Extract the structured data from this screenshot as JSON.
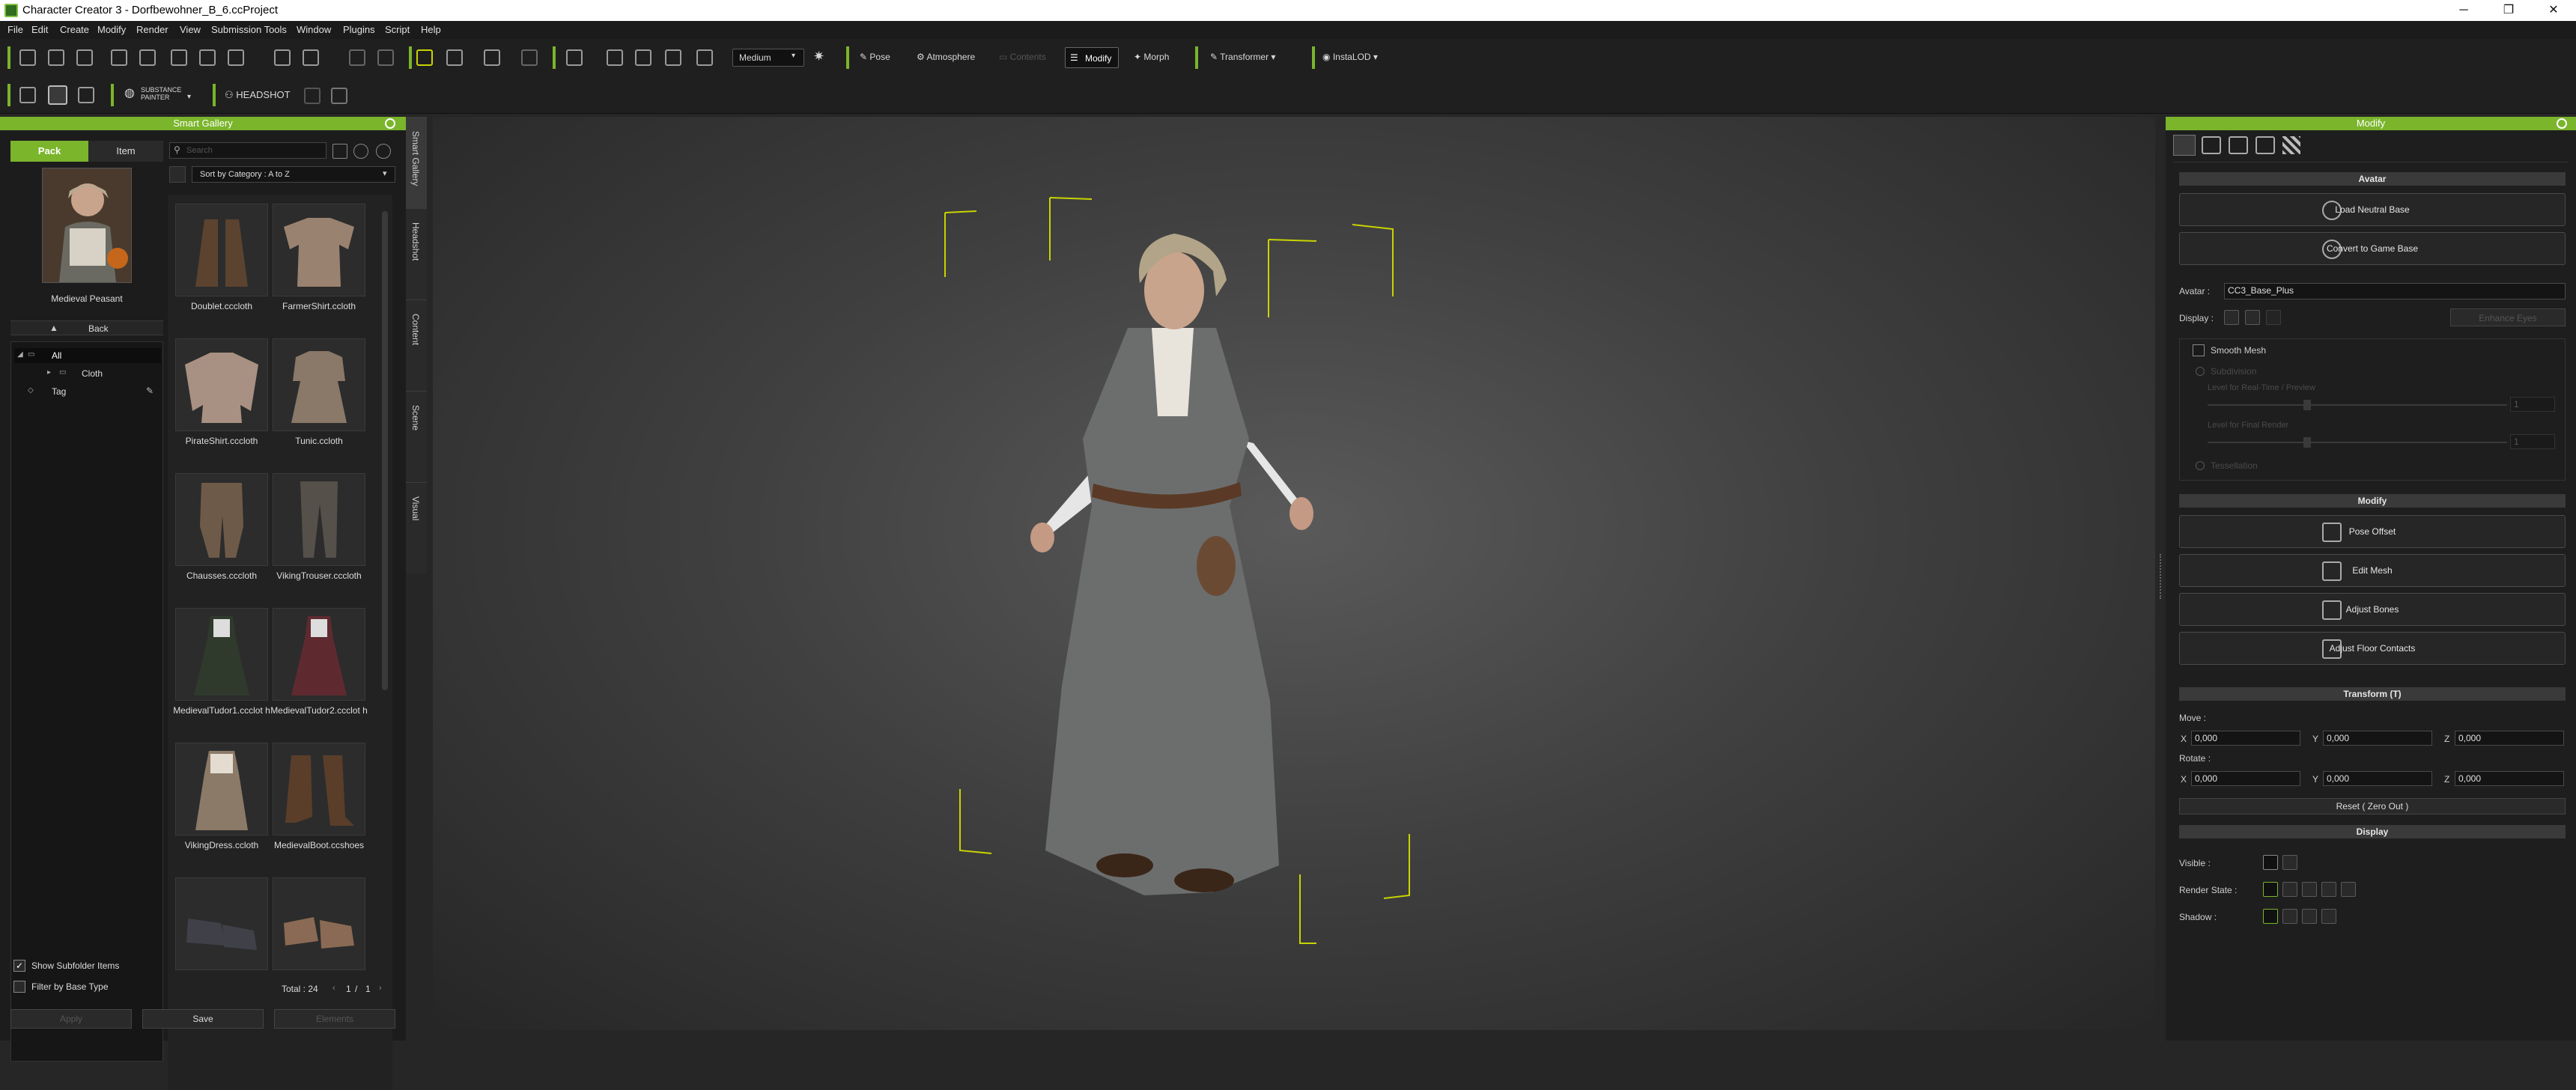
{
  "window": {
    "title": "Character Creator 3 - Dorfbewohner_B_6.ccProject",
    "minimize": "─",
    "maximize": "❐",
    "close": "✕"
  },
  "menu": [
    "File",
    "Edit",
    "Create",
    "Modify",
    "Render",
    "View",
    "Submission Tools",
    "Window",
    "Plugins",
    "Script",
    "Help"
  ],
  "toolbar": {
    "quality": "Medium",
    "pose": "Pose",
    "atmosphere": "Atmosphere",
    "contents": "Contents",
    "modify": "Modify",
    "morph": "Morph",
    "transformer": "Transformer",
    "instalod": "InstaLOD",
    "substance": "SUBSTANCE",
    "painter": "PAINTER",
    "headshot": "HEADSHOT"
  },
  "gallery": {
    "header": "Smart Gallery",
    "tab_pack": "Pack",
    "tab_item": "Item",
    "search_placeholder": "Search",
    "sort": "Sort by Category : A to Z",
    "pack_name": "Medieval Peasant",
    "back": "Back",
    "tree": {
      "all": "All",
      "cloth": "Cloth",
      "tag": "Tag"
    },
    "items": [
      "Doublet.cccloth",
      "FarmerShirt.ccloth",
      "PirateShirt.cccloth",
      "Tunic.ccloth",
      "Chausses.cccloth",
      "VikingTrouser.cccloth",
      "MedievalTudor1.ccclot h",
      "MedievalTudor2.ccclot h",
      "VikingDress.ccloth",
      "MedievalBoot.ccshoes",
      "",
      ""
    ],
    "show_subfolder": "Show Subfolder Items",
    "filter_base": "Filter by Base Type",
    "total": "Total : 24",
    "page": "1",
    "page_sep": "/",
    "page_total": "1",
    "apply": "Apply",
    "save": "Save",
    "elements": "Elements"
  },
  "side_tabs": [
    "Smart Gallery",
    "Headshot",
    "Content",
    "Scene",
    "Visual"
  ],
  "modify": {
    "header": "Modify",
    "avatar_section": "Avatar",
    "load_neutral": "Load Neutral Base",
    "convert_game": "Convert to Game Base",
    "avatar_label": "Avatar :",
    "avatar_value": "CC3_Base_Plus",
    "display_label": "Display :",
    "enhance": "Enhance Eyes",
    "smooth_mesh": "Smooth Mesh",
    "subdivision": "Subdivision",
    "lvl_realtime": "Level for Real-Time / Preview",
    "lvl_final": "Level for Final Render",
    "lvl_val1": "1",
    "lvl_val2": "1",
    "tessellation": "Tessellation",
    "modify_section": "Modify",
    "pose_offset": "Pose Offset",
    "edit_mesh": "Edit Mesh",
    "adjust_bones": "Adjust Bones",
    "adjust_floor": "Adjust Floor Contacts",
    "transform_section": "Transform  (T)",
    "move": "Move :",
    "rotate": "Rotate :",
    "x": "X",
    "y": "Y",
    "z": "Z",
    "move_x": "0,000",
    "move_y": "0,000",
    "move_z": "0,000",
    "rot_x": "0,000",
    "rot_y": "0,000",
    "rot_z": "0,000",
    "reset": "Reset ( Zero Out )",
    "display_section": "Display",
    "visible": "Visible :",
    "render_state": "Render State :",
    "shadow": "Shadow :"
  },
  "colors": {
    "accent": "#7ab52b",
    "panel": "#1c1c1c",
    "gizmo": "#c8d400"
  }
}
